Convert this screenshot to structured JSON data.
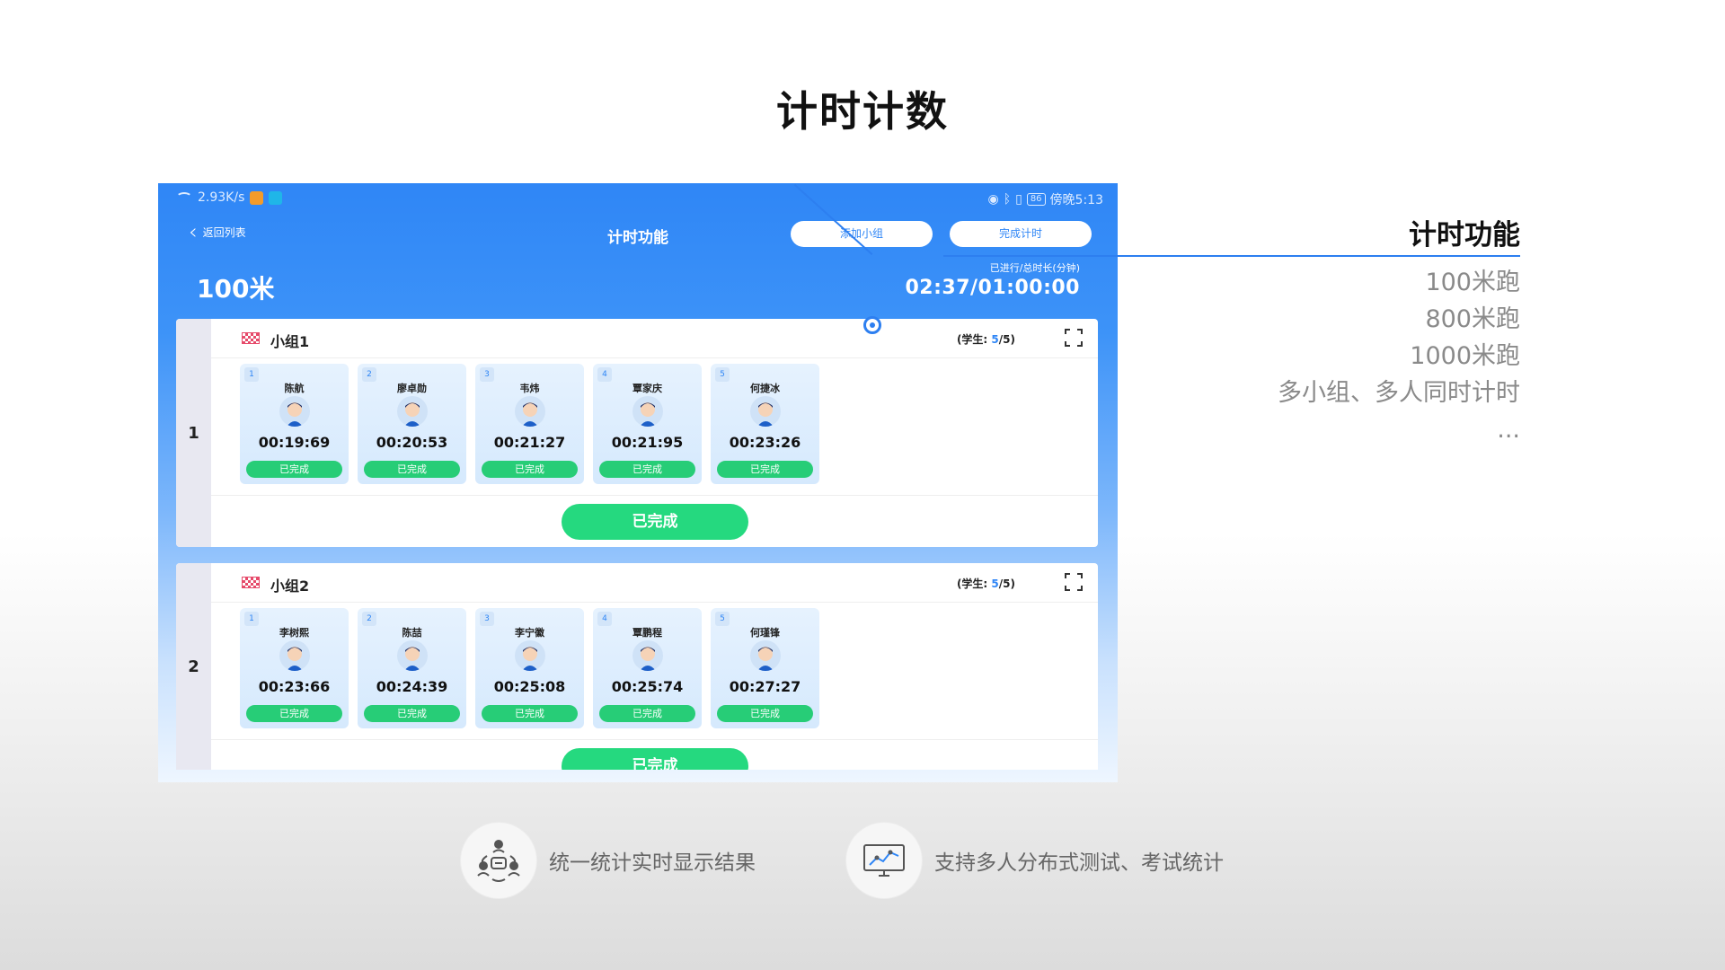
{
  "page_title": "计时计数",
  "tablet": {
    "statusbar": {
      "speed": "2.93K/s",
      "battery": "86",
      "time": "傍晚5:13"
    },
    "back_label": "返回列表",
    "screen_title": "计时功能",
    "add_group_label": "添加小组",
    "finish_timing_label": "完成计时",
    "event_name": "100米",
    "elapsed_label": "已进行/总时长(分钟)",
    "elapsed_value": "02:37/01:00:00",
    "groups": [
      {
        "index": "1",
        "name": "小组1",
        "count_prefix": "(学生:",
        "count_done": "5",
        "count_total": "/5)",
        "students": [
          {
            "num": "1",
            "name": "陈航",
            "time": "00:19:69",
            "status": "已完成"
          },
          {
            "num": "2",
            "name": "廖卓勋",
            "time": "00:20:53",
            "status": "已完成"
          },
          {
            "num": "3",
            "name": "韦炜",
            "time": "00:21:27",
            "status": "已完成"
          },
          {
            "num": "4",
            "name": "覃家庆",
            "time": "00:21:95",
            "status": "已完成"
          },
          {
            "num": "5",
            "name": "何捷冰",
            "time": "00:23:26",
            "status": "已完成"
          }
        ],
        "done_label": "已完成"
      },
      {
        "index": "2",
        "name": "小组2",
        "count_prefix": "(学生:",
        "count_done": "5",
        "count_total": "/5)",
        "students": [
          {
            "num": "1",
            "name": "李树熙",
            "time": "00:23:66",
            "status": "已完成"
          },
          {
            "num": "2",
            "name": "陈喆",
            "time": "00:24:39",
            "status": "已完成"
          },
          {
            "num": "3",
            "name": "李宁徽",
            "time": "00:25:08",
            "status": "已完成"
          },
          {
            "num": "4",
            "name": "覃鹏程",
            "time": "00:25:74",
            "status": "已完成"
          },
          {
            "num": "5",
            "name": "何瑾锋",
            "time": "00:27:27",
            "status": "已完成"
          }
        ],
        "done_label": "已完成"
      }
    ]
  },
  "side": {
    "title": "计时功能",
    "items": [
      "100米跑",
      "800米跑",
      "1000米跑",
      "多小组、多人同时计时",
      "..."
    ]
  },
  "features": [
    {
      "icon": "group-stats-icon",
      "text": "统一统计实时显示结果"
    },
    {
      "icon": "monitor-chart-icon",
      "text": "支持多人分布式测试、考试统计"
    }
  ],
  "colors": {
    "primary": "#2f86f6",
    "success": "#25d97f",
    "accent_line": "#2d7ff0"
  }
}
